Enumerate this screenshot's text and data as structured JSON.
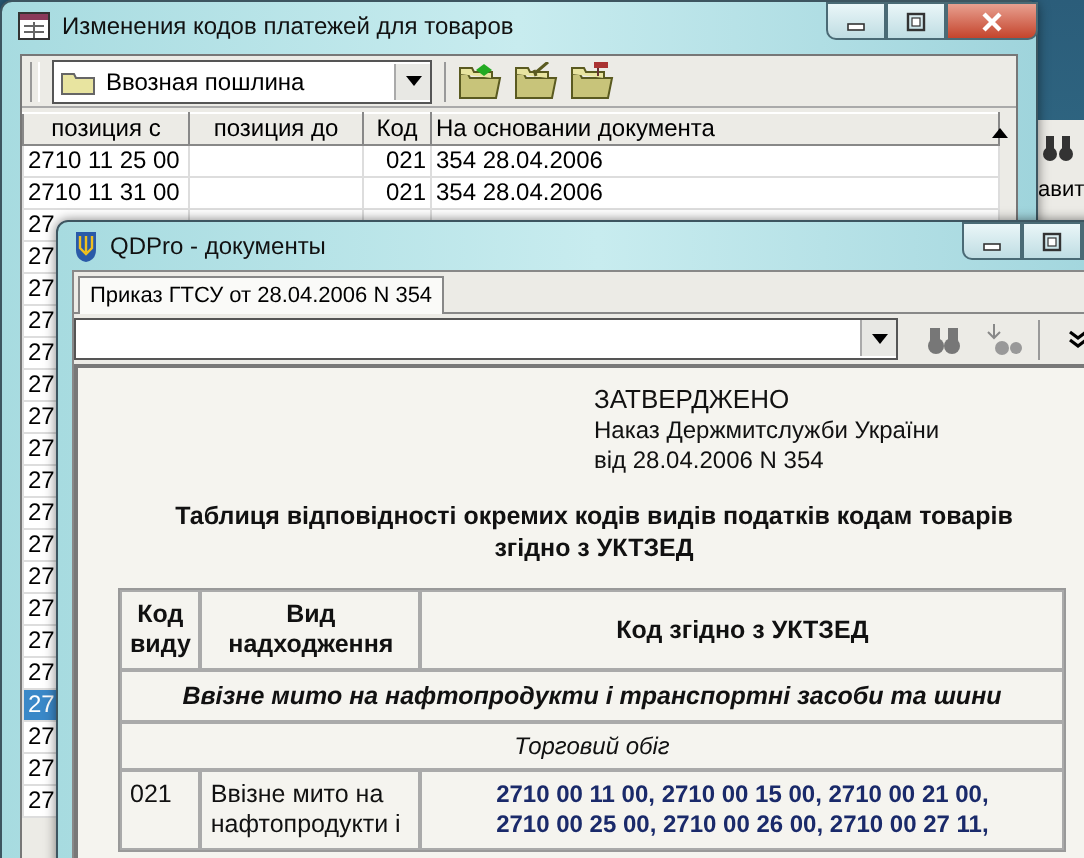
{
  "back_window": {
    "title": "Изменения кодов платежей для товаров",
    "combo": {
      "value": "Ввозная пошлина"
    },
    "table": {
      "columns": [
        "позиция с",
        "позиция до",
        "Код",
        "На основании документа"
      ],
      "rows": [
        {
          "position_from": "2710 11 25 00",
          "code": "021",
          "document": "354 28.04.2006",
          "selected": false
        },
        {
          "position_from": "2710 11 31 00",
          "code": "021",
          "document": "354 28.04.2006",
          "selected": false
        },
        {
          "position_from": "27",
          "selected": false
        },
        {
          "position_from": "27",
          "selected": false
        },
        {
          "position_from": "27",
          "selected": false
        },
        {
          "position_from": "27",
          "selected": false
        },
        {
          "position_from": "27",
          "selected": false
        },
        {
          "position_from": "27",
          "selected": false
        },
        {
          "position_from": "27",
          "selected": false
        },
        {
          "position_from": "27",
          "selected": false
        },
        {
          "position_from": "27",
          "selected": false
        },
        {
          "position_from": "27",
          "selected": false
        },
        {
          "position_from": "27",
          "selected": false
        },
        {
          "position_from": "27",
          "selected": false
        },
        {
          "position_from": "27",
          "selected": false
        },
        {
          "position_from": "27",
          "selected": false
        },
        {
          "position_from": "27",
          "selected": false
        },
        {
          "position_from": "27",
          "selected": true
        },
        {
          "position_from": "27",
          "selected": false
        },
        {
          "position_from": "27",
          "selected": false
        },
        {
          "position_from": "27",
          "selected": false
        }
      ]
    }
  },
  "other_window": {
    "text": "авит"
  },
  "front_window": {
    "title": "QDPro - документы",
    "tabs": [
      {
        "label": "Приказ ГТСУ от 28.04.2006 N 354",
        "selected": true
      }
    ],
    "document": {
      "approval": [
        "ЗАТВЕРДЖЕНО",
        "Наказ Держмитслужби України",
        "від 28.04.2006 N 354"
      ],
      "heading": "Таблиця відповідності окремих кодів видів податків кодам товарів згідно з УКТЗЕД",
      "columns": [
        "Код виду",
        "Вид надходження",
        "Код згідно з УКТЗЕД"
      ],
      "rows": [
        {
          "kind": "section",
          "text": "Ввізне мито на нафтопродукти і транспортні засоби та шини"
        },
        {
          "kind": "subsection",
          "text": "Торговий обіг"
        },
        {
          "kind": "entry",
          "code": "021",
          "name": "Ввізне мито на нафтопродукти і",
          "codes": "2710 00 11 00, 2710 00 15 00, 2710 00 21 00, 2710 00 25 00, 2710 00 26 00, 2710 00 27 11,"
        }
      ]
    }
  }
}
